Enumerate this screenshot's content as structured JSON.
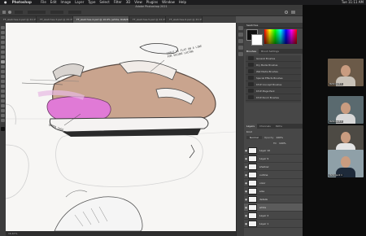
{
  "menubar": {
    "app": "Photoshop",
    "items": [
      "File",
      "Edit",
      "Image",
      "Layer",
      "Type",
      "Select",
      "Filter",
      "3D",
      "View",
      "Plugins",
      "Window",
      "Help"
    ],
    "clock": "Tue 11:11 AM"
  },
  "window": {
    "title": "Adobe Photoshop 2021"
  },
  "tabs": [
    {
      "label": "FF_sketches-2.psd @ 33.3% (Layer...",
      "active": false
    },
    {
      "label": "FF_sketches-3.psd @ 33.3% (Brush...",
      "active": false
    },
    {
      "label": "FF_sketches-4.psd @ 16.6% (white, RGB/8)",
      "active": true
    },
    {
      "label": "FF_sketches-5.psd @ 33.3% (Grou...",
      "active": false
    },
    {
      "label": "FF_sketches-6.psd @ 33.3% (Grou...",
      "active": false
    }
  ],
  "status": "16.67%",
  "panels": {
    "swatches_tab": "Swatches",
    "brushes_tab": "Brushes",
    "brush_settings_tab": "Brush Settings",
    "brush_items": [
      {
        "label": "General Brushes"
      },
      {
        "label": "Dry Media Brushes"
      },
      {
        "label": "Wet Media Brushes"
      },
      {
        "label": "Special Effects Brushes"
      },
      {
        "label": "KYLE Concept Brushes"
      },
      {
        "label": "KYLE Mega Pack"
      },
      {
        "label": "KYLE Pencil Brushes"
      }
    ],
    "layers_tabs": [
      "Layers",
      "Channels",
      "Paths"
    ],
    "kind_label": "Kind",
    "blend_mode": "Normal",
    "opacity_label": "Opacity",
    "opacity": "100%",
    "fill_label": "Fill",
    "fill": "100%",
    "layers": [
      {
        "name": "Layer 10",
        "selected": false
      },
      {
        "name": "Layer 9",
        "selected": false
      },
      {
        "name": "shadow",
        "selected": false
      },
      {
        "name": "outline",
        "selected": false
      },
      {
        "name": "color",
        "selected": false
      },
      {
        "name": "sole",
        "selected": false
      },
      {
        "name": "details",
        "selected": false
      },
      {
        "name": "white",
        "selected": true
      },
      {
        "name": "Layer 2",
        "selected": false
      },
      {
        "name": "Layer 1",
        "selected": false
      }
    ]
  },
  "canvas": {
    "annotation_top": "CABLE IS FLAT ON A LINE FOR SECURE LACING",
    "annotation_left": "UPPER CAGE"
  },
  "video": {
    "participants": [
      {
        "name": "Participant 1",
        "shirt": "#c9c2b8",
        "bg": "#6b5a48"
      },
      {
        "name": "Participant 2",
        "shirt": "#d8d8d8",
        "bg": "#5a6a6f"
      },
      {
        "name": "Participant 3",
        "shirt": "#e4e4e4",
        "bg": "#4d4a44"
      },
      {
        "name": "Participant 4",
        "shirt": "#1e2a3a",
        "bg": "#8fa0a8"
      }
    ]
  }
}
